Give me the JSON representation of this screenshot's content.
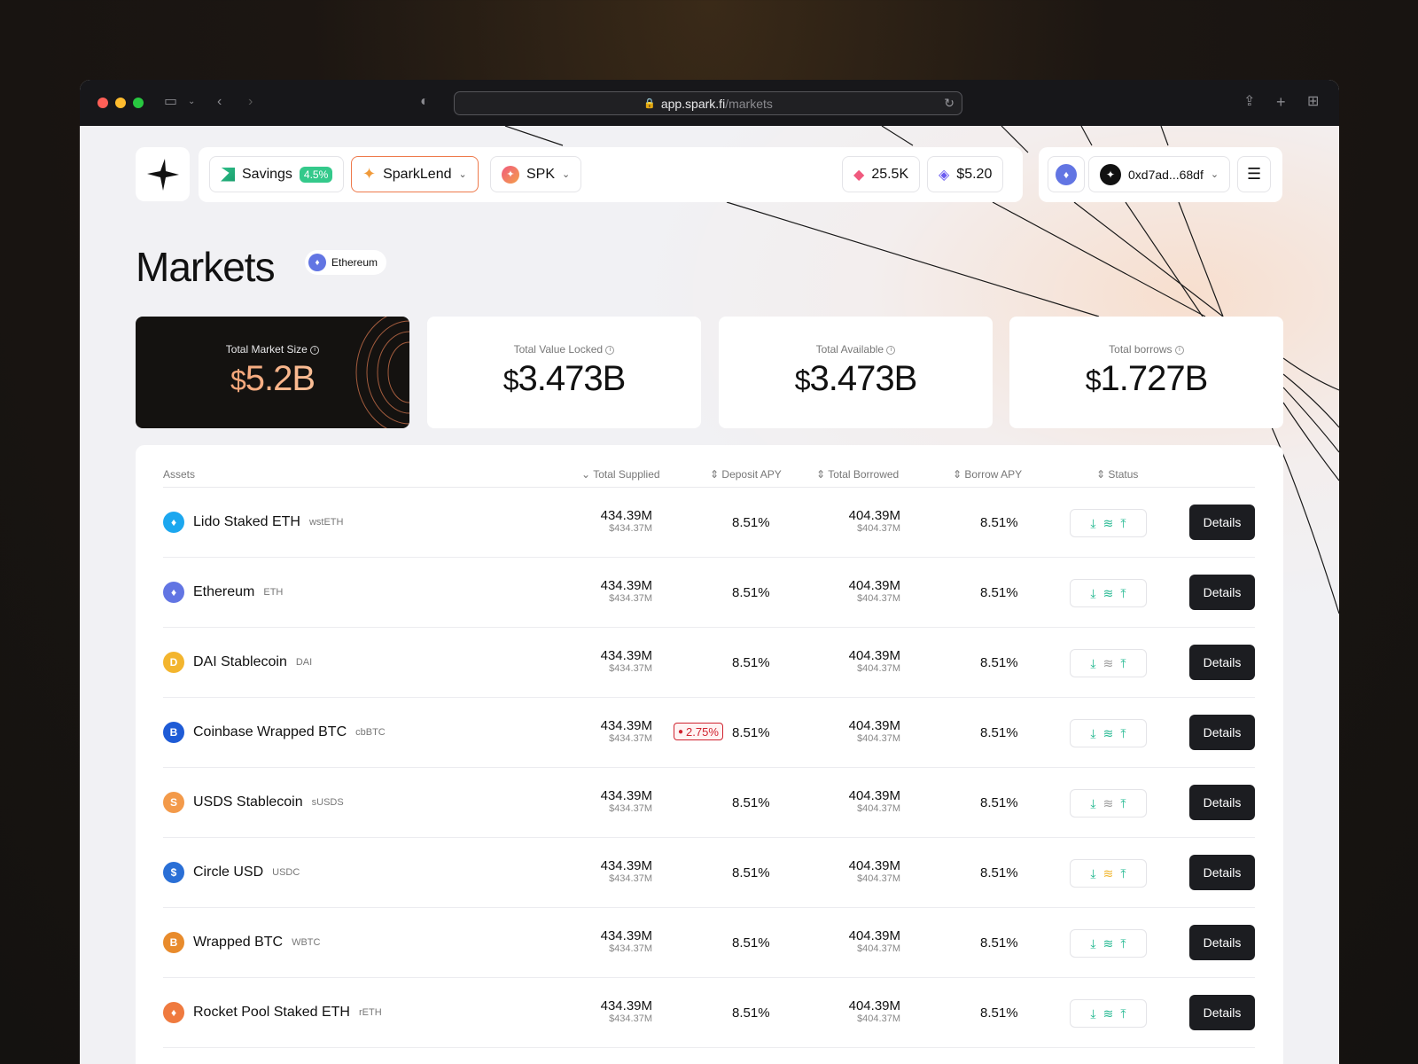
{
  "browser": {
    "url_host": "app.spark.fi",
    "url_path": "/markets"
  },
  "nav": {
    "savings_label": "Savings",
    "savings_rate": "4.5%",
    "sparklend_label": "SparkLend",
    "spk_label": "SPK",
    "points_value": "25.5K",
    "price_value": "$5.20",
    "wallet_address": "0xd7ad...68df"
  },
  "page": {
    "title": "Markets",
    "network": "Ethereum"
  },
  "stats": [
    {
      "label": "Total Market Size",
      "currency": "$",
      "value": "5.2B"
    },
    {
      "label": "Total Value Locked",
      "currency": "$",
      "value": "3.473B"
    },
    {
      "label": "Total Available",
      "currency": "$",
      "value": "3.473B"
    },
    {
      "label": "Total borrows",
      "currency": "$",
      "value": "1.727B"
    }
  ],
  "table": {
    "headers": {
      "assets": "Assets",
      "total_supplied": "Total Supplied",
      "deposit_apy": "Deposit APY",
      "total_borrowed": "Total Borrowed",
      "borrow_apy": "Borrow APY",
      "status": "Status"
    },
    "details_label": "Details",
    "rows": [
      {
        "name": "Lido Staked ETH",
        "symbol": "wstETH",
        "icon_color": "#1ca7ef",
        "glyph": "♦",
        "supplied": "434.39M",
        "supplied_usd": "$434.37M",
        "deposit_apy": "8.51%",
        "borrowed": "404.39M",
        "borrowed_usd": "$404.37M",
        "borrow_apy": "8.51%",
        "stack_color": "#22b890"
      },
      {
        "name": "Ethereum",
        "symbol": "ETH",
        "icon_color": "#6275e3",
        "glyph": "♦",
        "supplied": "434.39M",
        "supplied_usd": "$434.37M",
        "deposit_apy": "8.51%",
        "borrowed": "404.39M",
        "borrowed_usd": "$404.37M",
        "borrow_apy": "8.51%",
        "stack_color": "#22b890"
      },
      {
        "name": "DAI Stablecoin",
        "symbol": "DAI",
        "icon_color": "#f3b52e",
        "glyph": "D",
        "supplied": "434.39M",
        "supplied_usd": "$434.37M",
        "deposit_apy": "8.51%",
        "borrowed": "404.39M",
        "borrowed_usd": "$404.37M",
        "borrow_apy": "8.51%",
        "stack_color": "#999999"
      },
      {
        "name": "Coinbase Wrapped BTC",
        "symbol": "cbBTC",
        "icon_color": "#1e5bd6",
        "glyph": "B",
        "supplied": "434.39M",
        "supplied_usd": "$434.37M",
        "deposit_apy": "8.51%",
        "boost_apy": "2.75%",
        "borrowed": "404.39M",
        "borrowed_usd": "$404.37M",
        "borrow_apy": "8.51%",
        "stack_color": "#22b890"
      },
      {
        "name": "USDS Stablecoin",
        "symbol": "sUSDS",
        "icon_color": "#f39a4a",
        "glyph": "S",
        "supplied": "434.39M",
        "supplied_usd": "$434.37M",
        "deposit_apy": "8.51%",
        "borrowed": "404.39M",
        "borrowed_usd": "$404.37M",
        "borrow_apy": "8.51%",
        "stack_color": "#999999"
      },
      {
        "name": "Circle USD",
        "symbol": "USDC",
        "icon_color": "#2a6fd6",
        "glyph": "$",
        "supplied": "434.39M",
        "supplied_usd": "$434.37M",
        "deposit_apy": "8.51%",
        "borrowed": "404.39M",
        "borrowed_usd": "$404.37M",
        "borrow_apy": "8.51%",
        "stack_color": "#f0b429"
      },
      {
        "name": "Wrapped BTC",
        "symbol": "WBTC",
        "icon_color": "#e88b2c",
        "glyph": "B",
        "supplied": "434.39M",
        "supplied_usd": "$434.37M",
        "deposit_apy": "8.51%",
        "borrowed": "404.39M",
        "borrowed_usd": "$404.37M",
        "borrow_apy": "8.51%",
        "stack_color": "#22b890"
      },
      {
        "name": "Rocket Pool Staked ETH",
        "symbol": "rETH",
        "icon_color": "#ef7a3f",
        "glyph": "♦",
        "supplied": "434.39M",
        "supplied_usd": "$434.37M",
        "deposit_apy": "8.51%",
        "borrowed": "404.39M",
        "borrowed_usd": "$404.37M",
        "borrow_apy": "8.51%",
        "stack_color": "#22b890"
      }
    ]
  }
}
